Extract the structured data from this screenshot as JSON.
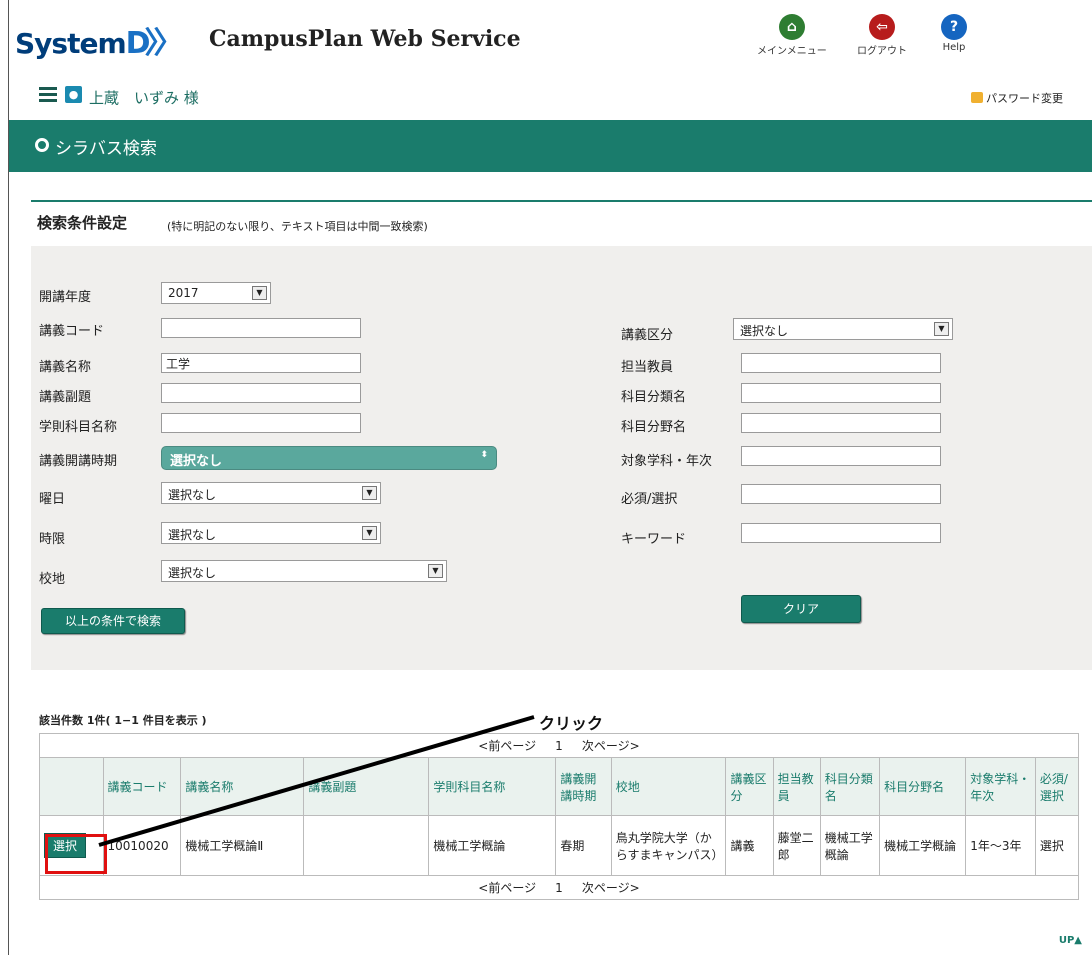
{
  "header": {
    "logo_text": "System",
    "service_title": "CampusPlan Web Service",
    "icons": [
      {
        "name": "home-icon",
        "label": "メインメニュー",
        "color": "#2e7d32"
      },
      {
        "name": "logout-icon",
        "label": "ログアウト",
        "color": "#b71c1c"
      },
      {
        "name": "help-icon",
        "label": "Help",
        "color": "#1565c0"
      }
    ]
  },
  "userbar": {
    "username": "上蔵　いずみ 様",
    "password_link": "パスワード変更"
  },
  "page_title": "シラバス検索",
  "search": {
    "title": "検索条件設定",
    "note": "(特に明記のない限り、テキスト項目は中間一致検索)",
    "left": {
      "year_label": "開講年度",
      "year_value": "2017",
      "code_label": "講義コード",
      "code_value": "",
      "name_label": "講義名称",
      "name_value": "工学",
      "subtitle_label": "講義副題",
      "subtitle_value": "",
      "school_subject_label": "学則科目名称",
      "school_subject_value": "",
      "period_label": "講義開講時期",
      "period_value": "選択なし",
      "day_label": "曜日",
      "day_value": "選択なし",
      "time_label": "時限",
      "time_value": "選択なし",
      "campus_label": "校地",
      "campus_value": "選択なし"
    },
    "right": {
      "category_label": "講義区分",
      "category_value": "選択なし",
      "teacher_label": "担当教員",
      "subject_class_label": "科目分類名",
      "subject_field_label": "科目分野名",
      "target_label": "対象学科・年次",
      "required_label": "必須/選択",
      "keyword_label": "キーワード"
    },
    "search_button": "以上の条件で検索",
    "clear_button": "クリア"
  },
  "results": {
    "count_text": "該当件数 1件( 1−1 件目を表示 )",
    "pager": {
      "prev": "<前ページ",
      "page": "1",
      "next": "次ページ>"
    },
    "headers": [
      "",
      "講義コード",
      "講義名称",
      "講義副題",
      "学則科目名称",
      "講義開講時期",
      "校地",
      "講義区分",
      "担当教員",
      "科目分類名",
      "科目分野名",
      "対象学科・年次",
      "必須/選択"
    ],
    "rows": [
      {
        "select_label": "選択",
        "code": "10010020",
        "name": "機械工学概論Ⅱ",
        "subtitle": "",
        "school_subject": "機械工学概論",
        "period": "春期",
        "campus": "鳥丸学院大学（からすまキャンパス）",
        "category": "講義",
        "teacher": "藤堂二郎",
        "subject_class": "機械工学概論",
        "subject_field": "機械工学概論",
        "target": "1年〜3年",
        "required": "選択"
      }
    ]
  },
  "annotation": "クリック",
  "up_link": "UP"
}
